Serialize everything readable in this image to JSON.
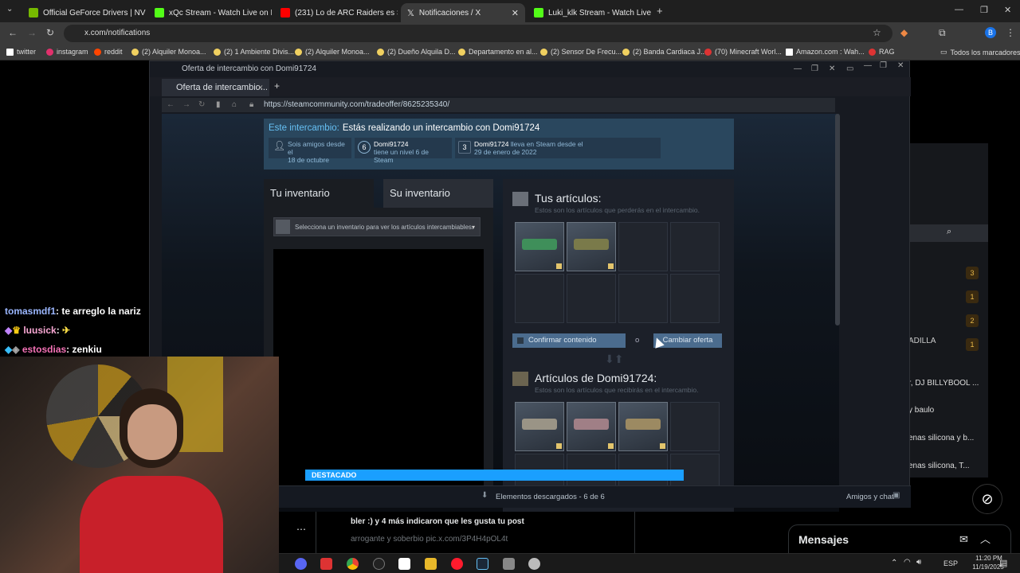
{
  "browser": {
    "tabs": [
      {
        "label": "Official GeForce Drivers | NVIDIA",
        "color": "#76b900",
        "active": false
      },
      {
        "label": "xQc Stream - Watch Live on Kick",
        "color": "#53fc18",
        "active": false
      },
      {
        "label": "(231) Lo de ARC Raiders es SAL",
        "color": "#ff0000",
        "active": false
      },
      {
        "label": "Notificaciones / X",
        "color": "#ffffff",
        "active": true
      },
      {
        "label": "Luki_klk Stream - Watch Live on",
        "color": "#53fc18",
        "active": false
      }
    ],
    "url": "x.com/notifications",
    "bookmarks": [
      "twitter",
      "instagram",
      "reddit",
      "(2) Alquiler Monoa...",
      "(2) 1 Ambiente Divis...",
      "(2) Alquiler Monoa...",
      "(2) Dueño Alquila D...",
      "Departamento en al...",
      "(2) Sensor De Frecu...",
      "(2) Banda Cardiaca J...",
      "(70) Minecraft Worl...",
      "Amazon.com : Wah...",
      "RAG"
    ],
    "all_bookmarks": "Todos los marcadores"
  },
  "steam": {
    "window_title": "Oferta de intercambio con Domi91724",
    "tab_label": "Oferta de intercambio...",
    "url": "https://steamcommunity.com/tradeoffer/8625235340/",
    "header": {
      "label": "Este intercambio:",
      "text": "Estás realizando un intercambio con Domi91724",
      "card1_line1": "Sois amigos desde el",
      "card1_line2": "18 de octubre",
      "card2_level": "6",
      "card2_name": "Domi91724",
      "card2_line2": "tiene un nivel 6 de Steam",
      "card3_num": "3",
      "card3_name": "Domi91724",
      "card3_line1_rest": " lleva en Steam desde el",
      "card3_line2": "29 de enero de 2022"
    },
    "left": {
      "tab_yours": "Tu inventario",
      "tab_theirs": "Su inventario",
      "select_placeholder": "Selecciona un inventario para ver los artículos intercambiables."
    },
    "right": {
      "your_items_title": "Tus artículos:",
      "your_items_sub": "Estos son los artículos que perderás en el intercambio.",
      "confirm_label": "Confirmar contenido",
      "or_label": "o",
      "change_label": "Cambiar oferta",
      "their_items_title": "Artículos de Domi91724:",
      "their_items_sub": "Estos son los artículos que recibirás en el intercambio."
    },
    "downloads": "Elementos descargados - 6 de 6",
    "friends": "Amigos y chat",
    "featured": "DESTACADO"
  },
  "chat": [
    {
      "user": "tomasmdf1",
      "msg": ": te arreglo la nariz"
    },
    {
      "user": "luusick",
      "msg": ": "
    },
    {
      "user": "estosdias",
      "msg": ": zenkiu"
    }
  ],
  "twitter": {
    "post_line1": "bler :) y 4 más indicaron que les gusta tu post",
    "post_line2": "arrogante y soberbio pic.x.com/3P4H4pOL4t",
    "messages": "Mensajes",
    "side_items": [
      "r, DJ BILLYBOOL ...",
      "y baulo",
      "enas silicona y b...",
      "enas silicona, T..."
    ],
    "badges": [
      "3",
      "1",
      "2",
      "1"
    ],
    "side_label": "ADILLA"
  },
  "taskbar": {
    "lang": "ESP",
    "time": "11:20 PM",
    "date": "11/19/2025"
  }
}
